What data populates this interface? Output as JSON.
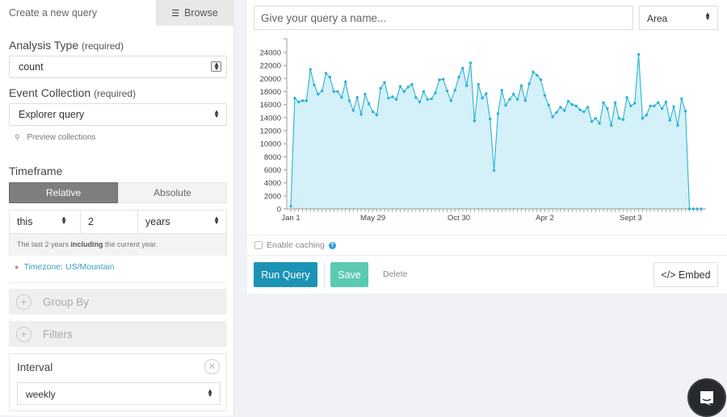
{
  "sidebar": {
    "tab_create": "Create a new query",
    "tab_browse": "Browse",
    "browse_icon": "list-icon",
    "analysis_type": {
      "label": "Analysis Type",
      "required": "(required)",
      "value": "count"
    },
    "event_collection": {
      "label": "Event Collection",
      "required": "(required)",
      "value": "Explorer query"
    },
    "preview_collections": "Preview collections",
    "timeframe": {
      "label": "Timeframe",
      "tabs": [
        "Relative",
        "Absolute"
      ],
      "active_tab": "Relative",
      "relativity": "this",
      "amount": "2",
      "units": "years",
      "note_pre": "The last 2 years ",
      "note_bold": "including",
      "note_post": " the current year."
    },
    "timezone": "Timezone: US/Mountain",
    "group_by": "Group By",
    "filters": "Filters",
    "interval": {
      "label": "Interval",
      "value": "weekly"
    }
  },
  "main": {
    "name_placeholder": "Give your query a name...",
    "chart_type": "Area",
    "enable_caching": "Enable caching",
    "help_glyph": "?",
    "run_query": "Run Query",
    "save": "Save",
    "delete": "Delete",
    "embed": "</> Embed"
  },
  "colors": {
    "line": "#2bb3d6",
    "fill": "#d4f0f8",
    "run": "#1b93b5",
    "save": "#5ccab3",
    "link": "#3a9dc5"
  },
  "chart_data": {
    "type": "area",
    "title": "",
    "xlabel": "",
    "ylabel": "",
    "ylim": [
      0,
      24000
    ],
    "yticks": [
      0,
      2000,
      4000,
      6000,
      8000,
      10000,
      12000,
      14000,
      16000,
      18000,
      20000,
      22000,
      24000
    ],
    "xtick_labels": [
      {
        "label": "Jan 1",
        "index": 0
      },
      {
        "label": "May 29",
        "index": 21
      },
      {
        "label": "Oct 30",
        "index": 43
      },
      {
        "label": "Apr 2",
        "index": 65
      },
      {
        "label": "Sept 3",
        "index": 87
      }
    ],
    "grid": false,
    "legend": "none",
    "values": [
      400,
      17000,
      16400,
      16600,
      16600,
      21400,
      19000,
      17600,
      18100,
      20800,
      20200,
      18000,
      18000,
      17100,
      19500,
      16600,
      15100,
      17100,
      14500,
      17600,
      16100,
      14900,
      14400,
      18500,
      19400,
      17000,
      17200,
      16800,
      18800,
      18000,
      18700,
      19100,
      17100,
      16400,
      18000,
      16800,
      16900,
      17800,
      19800,
      19900,
      18100,
      16600,
      18200,
      20200,
      21600,
      18900,
      22400,
      13500,
      19100,
      17000,
      17700,
      13800,
      5900,
      14600,
      18200,
      15900,
      16800,
      17600,
      16800,
      18900,
      16600,
      19200,
      21000,
      20500,
      19800,
      17400,
      15900,
      14100,
      14800,
      15600,
      15100,
      16500,
      16000,
      15800,
      15200,
      14900,
      15600,
      13400,
      13900,
      13100,
      16300,
      15400,
      12800,
      16300,
      13900,
      13700,
      17100,
      15800,
      16200,
      23700,
      13900,
      14400,
      15800,
      15800,
      16300,
      15400,
      16400,
      13600,
      15700,
      12800,
      16900,
      15000,
      0,
      0,
      0,
      0
    ]
  }
}
